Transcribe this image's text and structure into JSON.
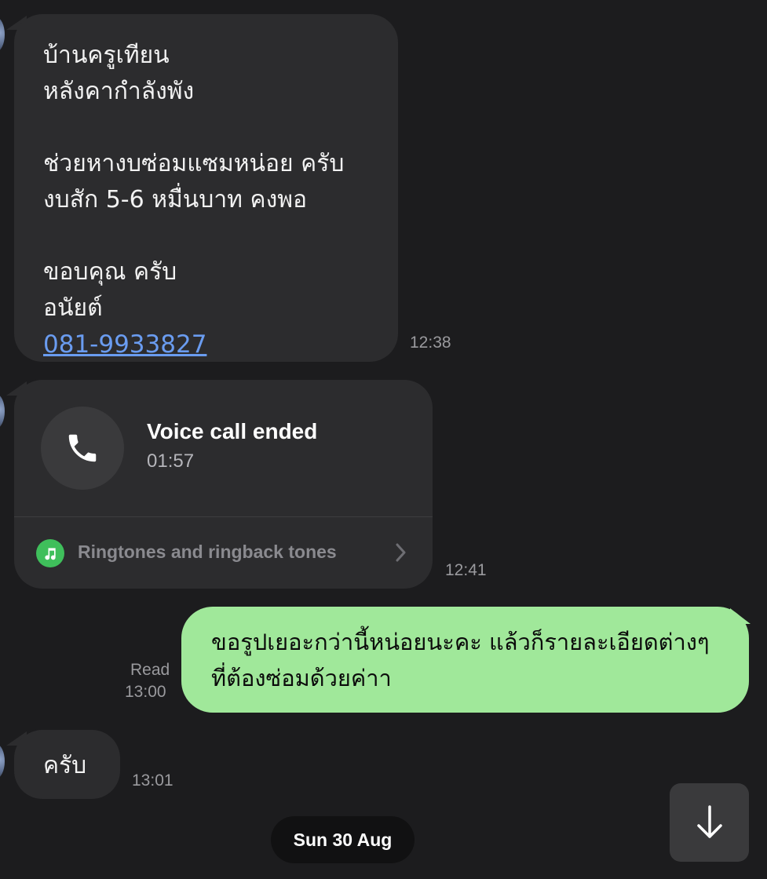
{
  "messages": {
    "incoming_1": {
      "lines": "บ้านครูเทียน\nหลังคากำลังพัง\n\nช่วยหางบซ่อมแซมหน่อย ครับ\nงบสัก 5-6 หมื่นบาท คงพอ\n\nขอบคุณ ครับ\nอนัยต์",
      "phone": "081-9933827",
      "time": "12:38"
    },
    "voice_call": {
      "title": "Voice call ended",
      "duration": "01:57",
      "ringtones_label": "Ringtones and ringback tones",
      "time": "12:41"
    },
    "outgoing_1": {
      "text": "ขอรูปเยอะกว่านี้หน่อยนะคะ แล้วก็รายละเอียดต่างๆ ที่ต้องซ่อมด้วยค่าา",
      "read_label": "Read",
      "time": "13:00"
    },
    "incoming_2": {
      "text": "ครับ",
      "time": "13:01"
    }
  },
  "date_divider": "Sun 30 Aug",
  "icons": {
    "call": "phone-icon",
    "ringtone": "music-note-icon",
    "chevron": "chevron-right-icon",
    "scroll": "arrow-down-icon"
  },
  "colors": {
    "background": "#1c1c1e",
    "incoming_bubble": "#2c2c2e",
    "outgoing_bubble": "#a0e89a",
    "link": "#6a9cf0",
    "ringtone_green": "#3fbf5b"
  }
}
